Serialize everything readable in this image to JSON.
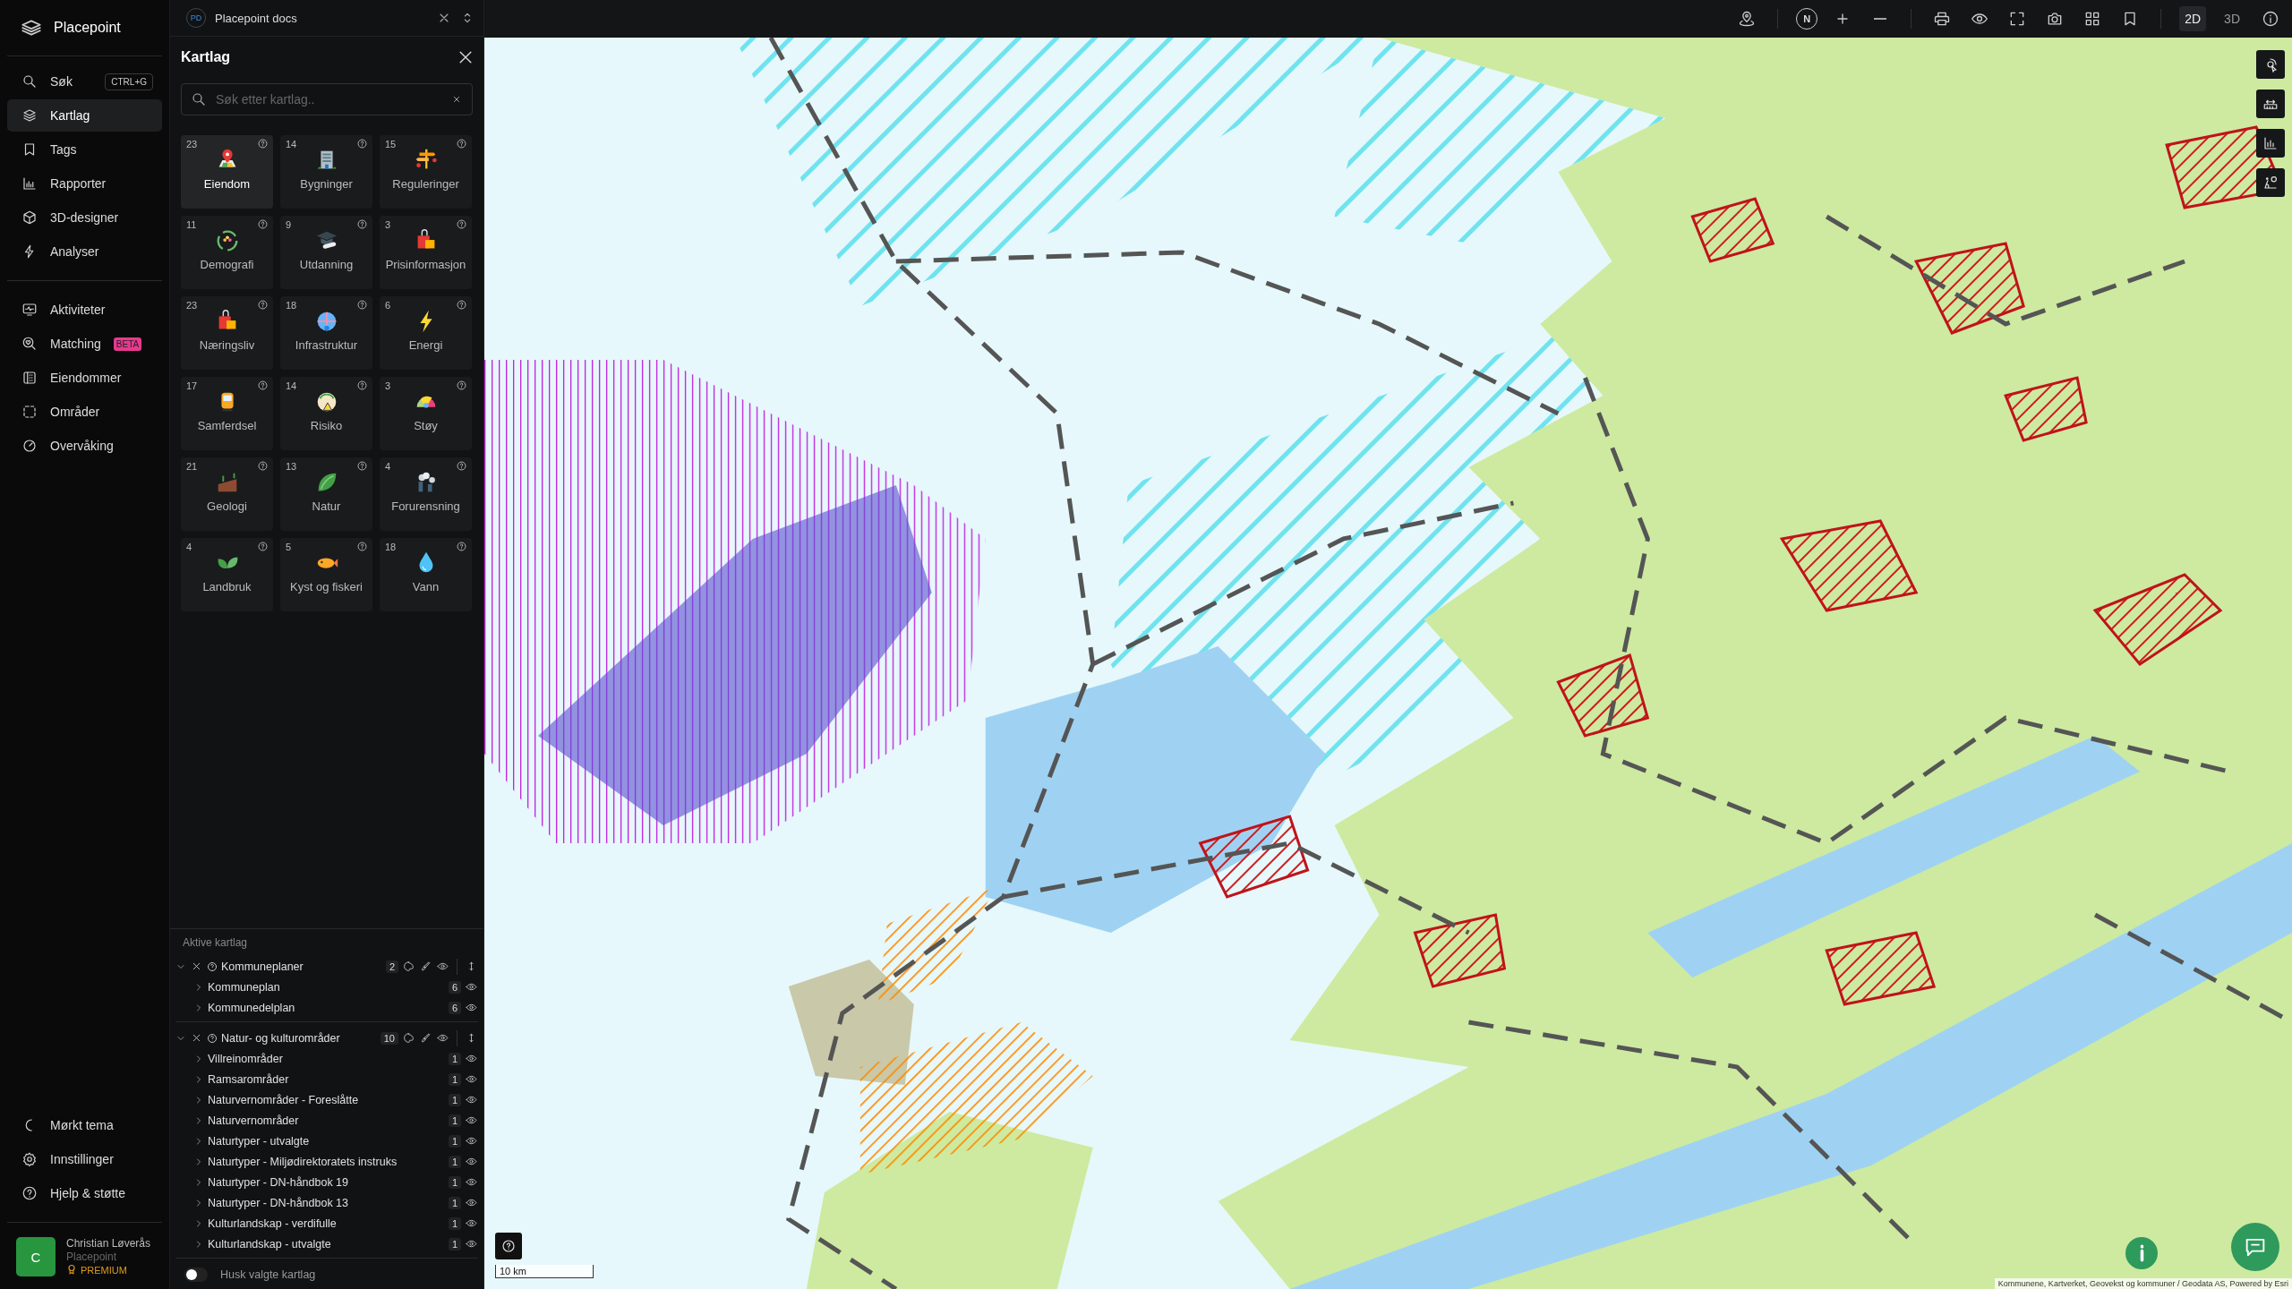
{
  "app": {
    "name": "Placepoint"
  },
  "nav_main": [
    {
      "kind": "search",
      "label": "Søk",
      "shortcut": "CTRL+G",
      "selected": false
    },
    {
      "kind": "layers",
      "label": "Kartlag",
      "selected": true
    },
    {
      "kind": "bookmark",
      "label": "Tags",
      "selected": false
    },
    {
      "kind": "chart",
      "label": "Rapporter",
      "selected": false
    },
    {
      "kind": "cube",
      "label": "3D-designer",
      "selected": false
    },
    {
      "kind": "bolt",
      "label": "Analyser",
      "selected": false
    }
  ],
  "nav_secondary": [
    {
      "kind": "monitor",
      "label": "Aktiviteter",
      "selected": false
    },
    {
      "kind": "match",
      "label": "Matching",
      "badge": "BETA",
      "selected": false
    },
    {
      "kind": "building",
      "label": "Eiendommer",
      "selected": false
    },
    {
      "kind": "area",
      "label": "Områder",
      "selected": false
    },
    {
      "kind": "gauge",
      "label": "Overvåking",
      "selected": false
    }
  ],
  "nav_bottom": [
    {
      "kind": "moon",
      "label": "Mørkt tema"
    },
    {
      "kind": "gear",
      "label": "Innstillinger"
    },
    {
      "kind": "help",
      "label": "Hjelp & støtte"
    }
  ],
  "user": {
    "initial": "C",
    "name": "Christian Løverås",
    "org": "Placepoint",
    "plan": "PREMIUM"
  },
  "workspace": {
    "initials": "PD",
    "name": "Placepoint docs"
  },
  "panel": {
    "title": "Kartlag",
    "search": {
      "placeholder": "Søk etter kartlag.."
    },
    "categories": [
      {
        "count": "23",
        "label": "Eiendom",
        "kind": "pin",
        "selected": true
      },
      {
        "count": "14",
        "label": "Bygninger",
        "kind": "building",
        "selected": false
      },
      {
        "count": "15",
        "label": "Reguleringer",
        "kind": "sign",
        "selected": false
      },
      {
        "count": "11",
        "label": "Demografi",
        "kind": "ring",
        "selected": false
      },
      {
        "count": "9",
        "label": "Utdanning",
        "kind": "cap",
        "selected": false
      },
      {
        "count": "3",
        "label": "Prisinformasjon",
        "kind": "bag",
        "selected": false
      },
      {
        "count": "23",
        "label": "Næringsliv",
        "kind": "bag",
        "selected": false
      },
      {
        "count": "18",
        "label": "Infrastruktur",
        "kind": "globe",
        "selected": false
      },
      {
        "count": "6",
        "label": "Energi",
        "kind": "bolt",
        "selected": false
      },
      {
        "count": "17",
        "label": "Samferdsel",
        "kind": "bus",
        "selected": false
      },
      {
        "count": "14",
        "label": "Risiko",
        "kind": "warn",
        "selected": false
      },
      {
        "count": "3",
        "label": "Støy",
        "kind": "dial",
        "selected": false
      },
      {
        "count": "21",
        "label": "Geologi",
        "kind": "soil",
        "selected": false
      },
      {
        "count": "13",
        "label": "Natur",
        "kind": "leaf",
        "selected": false
      },
      {
        "count": "4",
        "label": "Forurensning",
        "kind": "factory",
        "selected": false
      },
      {
        "count": "4",
        "label": "Landbruk",
        "kind": "sprout",
        "selected": false
      },
      {
        "count": "5",
        "label": "Kyst og fiskeri",
        "kind": "fish",
        "selected": false
      },
      {
        "count": "18",
        "label": "Vann",
        "kind": "drop",
        "selected": false
      }
    ]
  },
  "active_layers": {
    "title": "Aktive kartlag",
    "groups": [
      {
        "name": "Kommuneplaner",
        "count": "2",
        "expanded": true,
        "children": [
          {
            "name": "Kommuneplan",
            "count": "6",
            "expanded": false
          },
          {
            "name": "Kommunedelplan",
            "count": "6",
            "expanded": false
          }
        ]
      },
      {
        "name": "Natur- og kulturområder",
        "count": "10",
        "expanded": true,
        "children": [
          {
            "name": "Villreinområder",
            "count": "1",
            "expanded": false
          },
          {
            "name": "Ramsarområder",
            "count": "1",
            "expanded": false
          },
          {
            "name": "Naturvernområder - Foreslåtte",
            "count": "1",
            "expanded": false
          },
          {
            "name": "Naturvernområder",
            "count": "1",
            "expanded": false
          },
          {
            "name": "Naturtyper - utvalgte",
            "count": "1",
            "expanded": false
          },
          {
            "name": "Naturtyper - Miljødirektoratets instruks",
            "count": "1",
            "expanded": false
          },
          {
            "name": "Naturtyper - DN-håndbok 19",
            "count": "1",
            "expanded": false
          },
          {
            "name": "Naturtyper - DN-håndbok 13",
            "count": "1",
            "expanded": false
          },
          {
            "name": "Kulturlandskap - verdifulle",
            "count": "1",
            "expanded": false
          },
          {
            "name": "Kulturlandskap - utvalgte",
            "count": "1",
            "expanded": false
          }
        ]
      }
    ]
  },
  "remember": {
    "label": "Husk valgte kartlag",
    "on": false
  },
  "toolbar": {
    "compass": "N",
    "modes": [
      {
        "label": "2D",
        "selected": true
      },
      {
        "label": "3D",
        "selected": false
      }
    ]
  },
  "map": {
    "scale": "10 km",
    "attribution": "Kommunene, Kartverket, Geovekst og kommuner / Geodata AS, Powered by Esri"
  }
}
